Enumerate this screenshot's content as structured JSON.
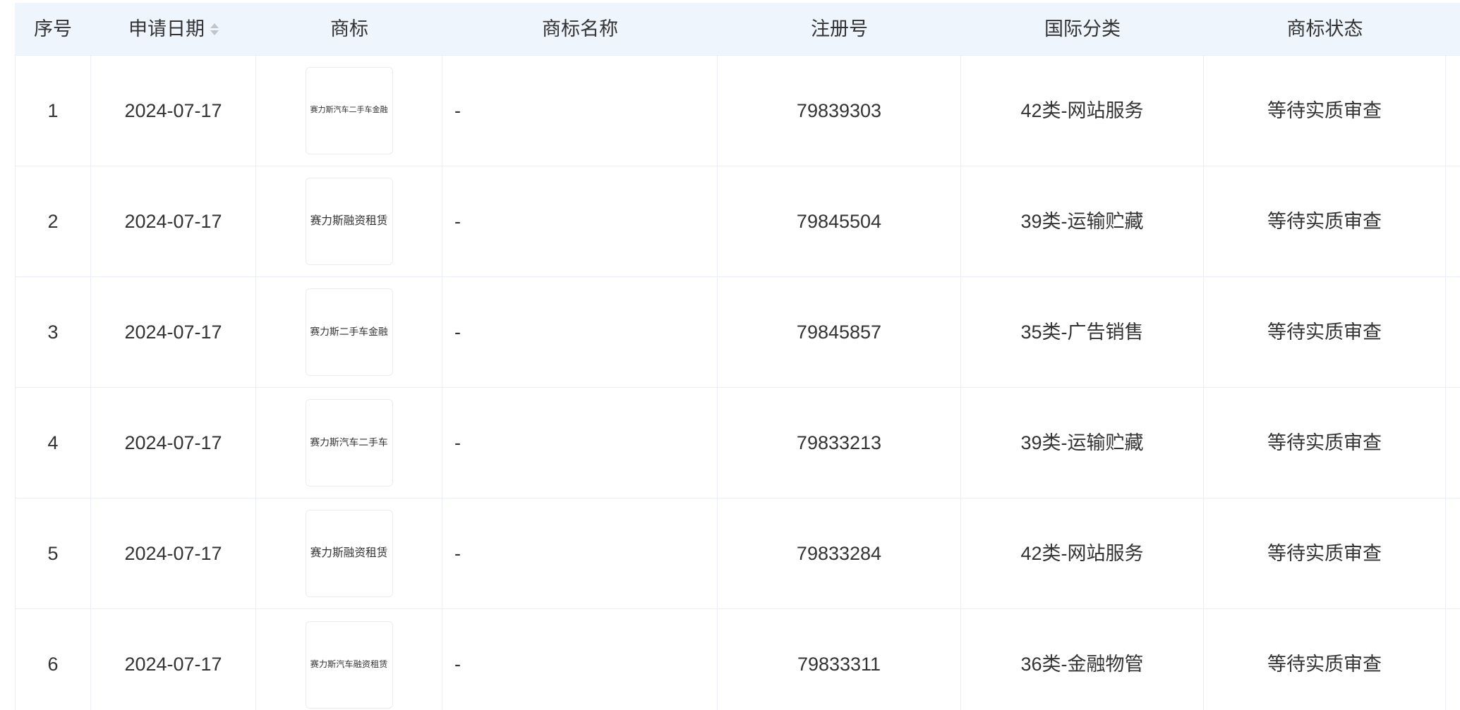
{
  "colors": {
    "header_bg": "#eef5fd",
    "border": "#ebeef5",
    "text": "#333333",
    "sort_icon": "#c0c4cc"
  },
  "icons": {
    "date_sort": "sort-caret-icon"
  },
  "table": {
    "columns": [
      "序号",
      "申请日期",
      "商标",
      "商标名称",
      "注册号",
      "国际分类",
      "商标状态"
    ],
    "rows": [
      {
        "index": "1",
        "date": "2024-07-17",
        "trademark_image_text": "赛力斯汽车二手车金融",
        "trademark_name": "-",
        "reg_no": "79839303",
        "intl_class": "42类-网站服务",
        "status": "等待实质审查"
      },
      {
        "index": "2",
        "date": "2024-07-17",
        "trademark_image_text": "赛力斯融资租赁",
        "trademark_name": "-",
        "reg_no": "79845504",
        "intl_class": "39类-运输贮藏",
        "status": "等待实质审查"
      },
      {
        "index": "3",
        "date": "2024-07-17",
        "trademark_image_text": "赛力斯二手车金融",
        "trademark_name": "-",
        "reg_no": "79845857",
        "intl_class": "35类-广告销售",
        "status": "等待实质审查"
      },
      {
        "index": "4",
        "date": "2024-07-17",
        "trademark_image_text": "赛力斯汽车二手车",
        "trademark_name": "-",
        "reg_no": "79833213",
        "intl_class": "39类-运输贮藏",
        "status": "等待实质审查"
      },
      {
        "index": "5",
        "date": "2024-07-17",
        "trademark_image_text": "赛力斯融资租赁",
        "trademark_name": "-",
        "reg_no": "79833284",
        "intl_class": "42类-网站服务",
        "status": "等待实质审查"
      },
      {
        "index": "6",
        "date": "2024-07-17",
        "trademark_image_text": "赛力斯汽车融资租赁",
        "trademark_name": "-",
        "reg_no": "79833311",
        "intl_class": "36类-金融物管",
        "status": "等待实质审查"
      }
    ]
  }
}
